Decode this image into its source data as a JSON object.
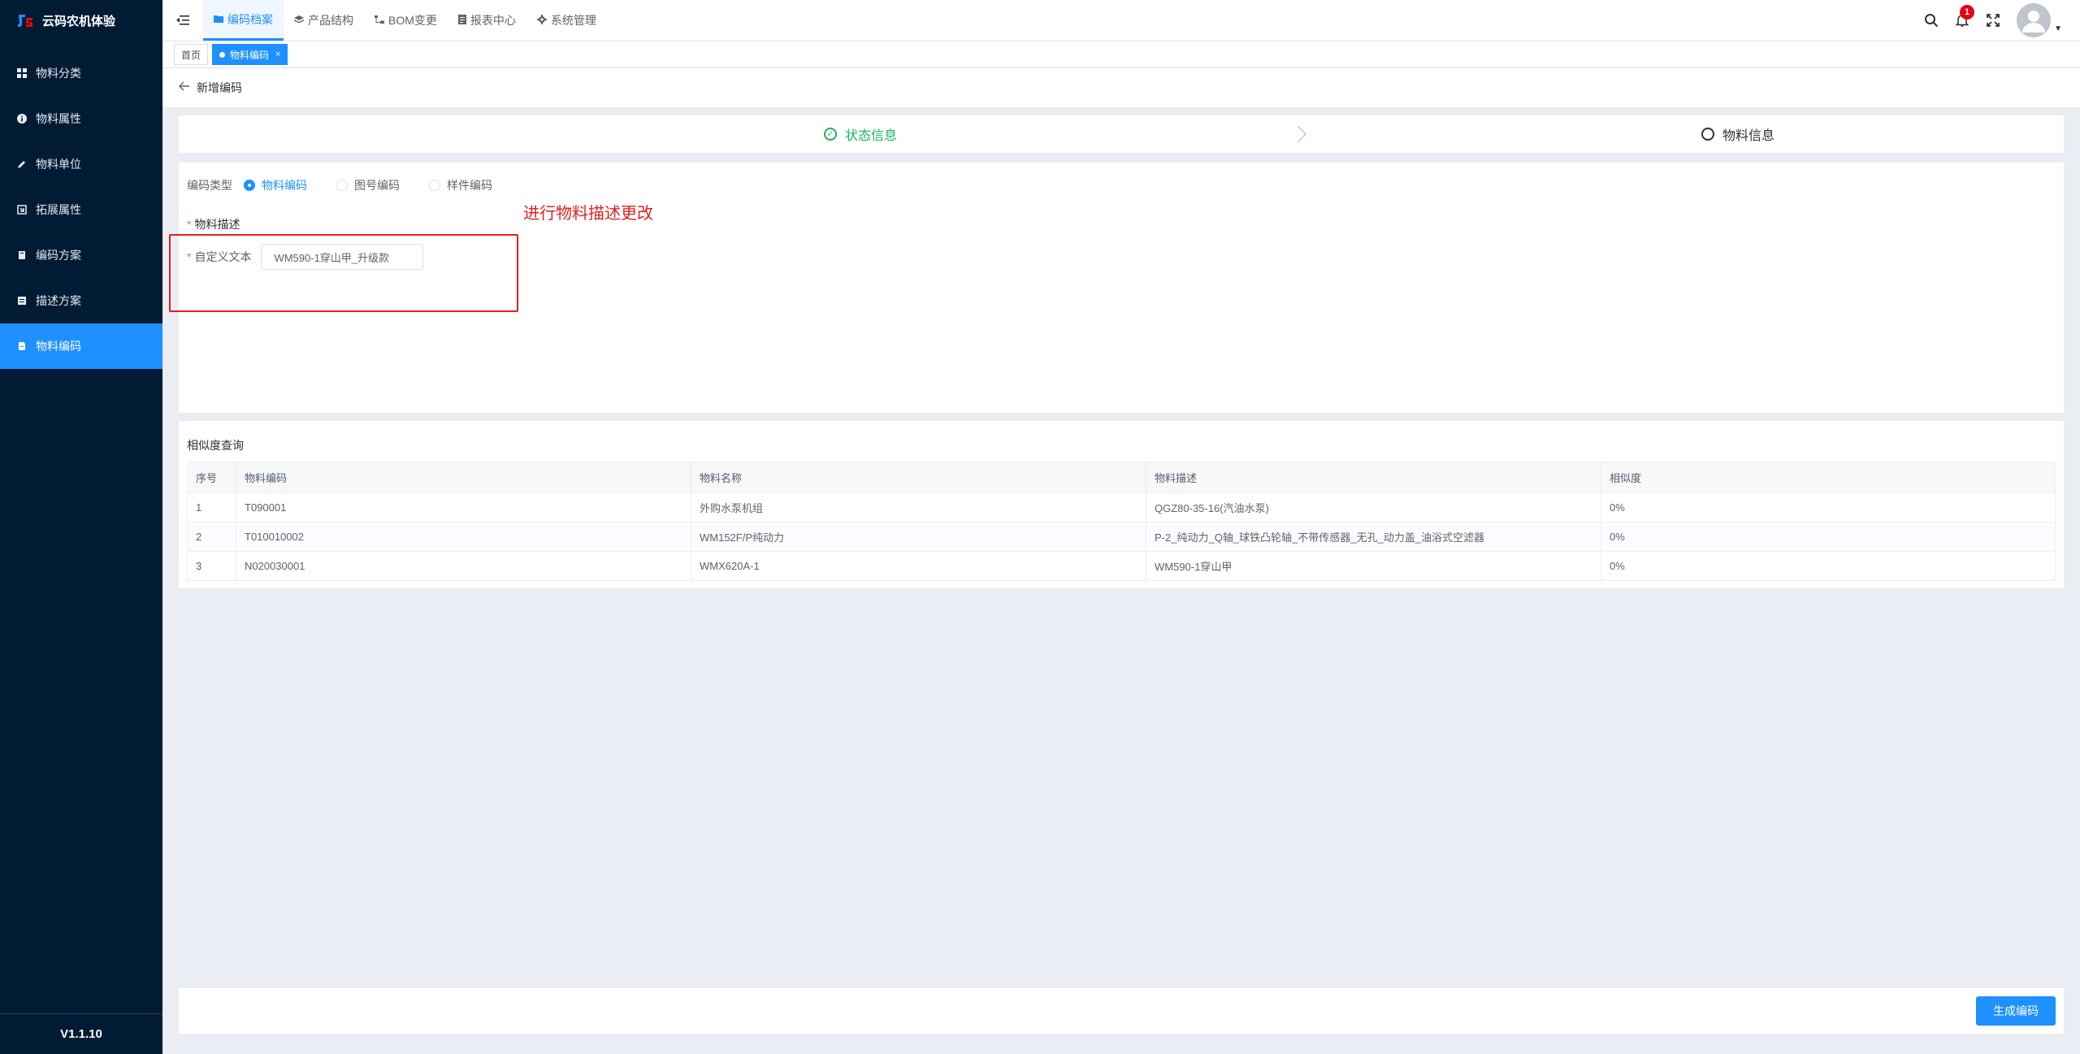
{
  "app": {
    "title": "云码农机体验",
    "version": "V1.1.10"
  },
  "sidebar": {
    "items": [
      {
        "label": "物料分类",
        "icon": "grid-icon"
      },
      {
        "label": "物料属性",
        "icon": "info-icon"
      },
      {
        "label": "物料单位",
        "icon": "pencil-icon"
      },
      {
        "label": "拓展属性",
        "icon": "expand-icon"
      },
      {
        "label": "编码方案",
        "icon": "doc-icon"
      },
      {
        "label": "描述方案",
        "icon": "list-icon"
      },
      {
        "label": "物料编码",
        "icon": "file-icon",
        "active": true
      }
    ]
  },
  "topnav": {
    "items": [
      {
        "label": "编码档案",
        "active": true
      },
      {
        "label": "产品结构"
      },
      {
        "label": "BOM变更"
      },
      {
        "label": "报表中心"
      },
      {
        "label": "系统管理"
      }
    ]
  },
  "header": {
    "notification_count": "1"
  },
  "tags": {
    "home": "首页",
    "current": "物料编码",
    "close": "×"
  },
  "page": {
    "title": "新增编码"
  },
  "steps": {
    "step1": "状态信息",
    "step2": "物料信息"
  },
  "form": {
    "code_type_label": "编码类型",
    "radios": [
      "物料编码",
      "图号编码",
      "样件编码"
    ],
    "required_mark": "*",
    "desc_label": "物料描述",
    "custom_text_label": "自定义文本",
    "custom_text_value": "WM590-1穿山甲_升级款"
  },
  "annotation": {
    "text": "进行物料描述更改"
  },
  "similarity": {
    "title": "相似度查询",
    "columns": [
      "序号",
      "物料编码",
      "物料名称",
      "物料描述",
      "相似度"
    ],
    "rows": [
      [
        "1",
        "T090001",
        "外购水泵机组",
        "QGZ80-35-16(汽油水泵)",
        "0%"
      ],
      [
        "2",
        "T010010002",
        "WM152F/P纯动力",
        "P-2_纯动力_Q轴_球铁凸轮轴_不带传感器_无孔_动力盖_油浴式空滤器",
        "0%"
      ],
      [
        "3",
        "N020030001",
        "WMX620A-1",
        "WM590-1穿山甲",
        "0%"
      ]
    ]
  },
  "footer": {
    "generate_label": "生成编码"
  },
  "colors": {
    "primary": "#1e90ff",
    "sidebar_bg": "#001b33",
    "success": "#1fb35c",
    "annotation": "#e02020"
  }
}
